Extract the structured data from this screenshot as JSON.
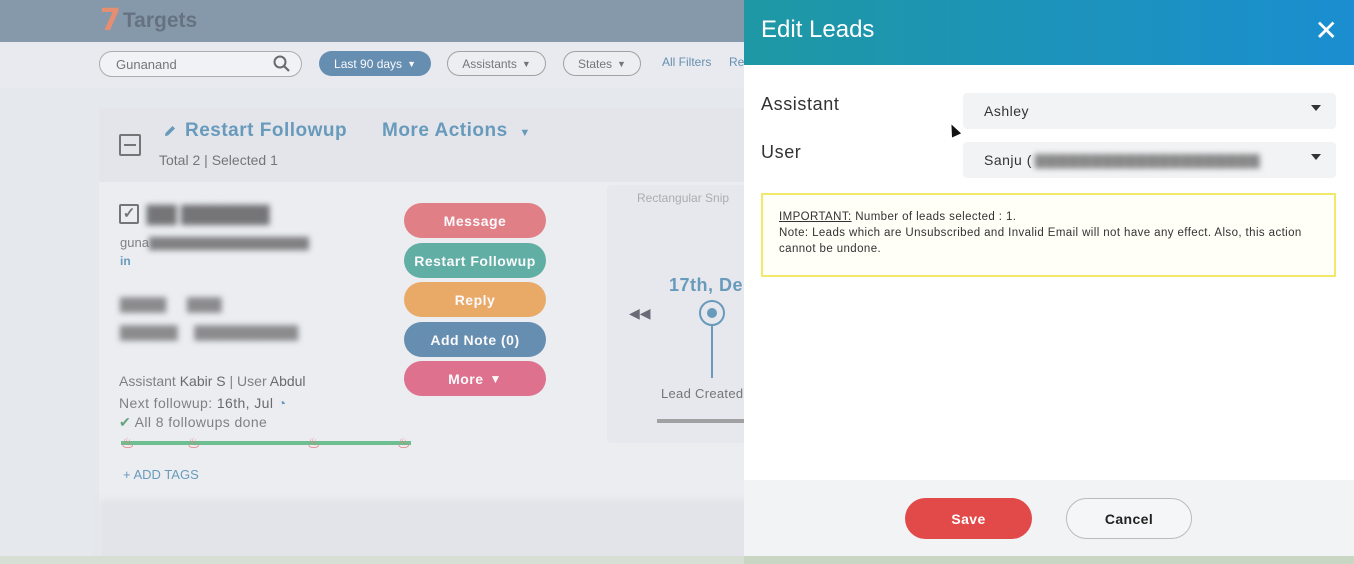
{
  "app": {
    "logo_mark": "7",
    "logo_text": "Targets"
  },
  "filters": {
    "search_value": "Gunanand",
    "date_range": "Last 90 days",
    "assistants": "Assistants",
    "states": "States",
    "all_filters": "All Filters",
    "reset_partial": "Re"
  },
  "bulk": {
    "restart_followup": "Restart Followup",
    "more_actions": "More Actions",
    "total_label": "Total",
    "total_count": "2",
    "selected_label": "Selected",
    "selected_count": "1"
  },
  "lead": {
    "email_prefix": "guna",
    "social": "in",
    "assistant_label": "Assistant",
    "assistant_name": "Kabir S",
    "user_label": "User",
    "user_name": "Abdul",
    "next_followup_label": "Next followup:",
    "next_followup_date": "16th, Jul",
    "followups_done": "All 8 followups done",
    "followups_total": 8,
    "followups_completed": 8,
    "add_tags": "ADD TAGS"
  },
  "actions": {
    "message": "Message",
    "restart_followup": "Restart Followup",
    "reply": "Reply",
    "add_note": "Add Note (0)",
    "more": "More"
  },
  "timeline": {
    "snip_label": "Rectangular Snip",
    "date": "17th, De",
    "lead_created": "Lead Created"
  },
  "modal": {
    "title": "Edit Leads",
    "assistant_label": "Assistant",
    "assistant_value": "Ashley",
    "user_label": "User",
    "user_value": "Sanju (",
    "notice_important": "IMPORTANT:",
    "notice_count": "Number of leads selected : 1.",
    "notice_note": "Note: Leads which are Unsubscribed and Invalid Email will not have any effect. Also, this action cannot be undone.",
    "save": "Save",
    "cancel": "Cancel"
  },
  "colors": {
    "header_gradient_start": "#1e98a4",
    "header_gradient_end": "#1a8ed0",
    "save_red": "#e24a4a",
    "message_red": "#d9434b",
    "restart_teal": "#148a78",
    "reply_orange": "#e5851d",
    "addnote_blue": "#1d5a8c",
    "more_crimson": "#d42f56"
  }
}
